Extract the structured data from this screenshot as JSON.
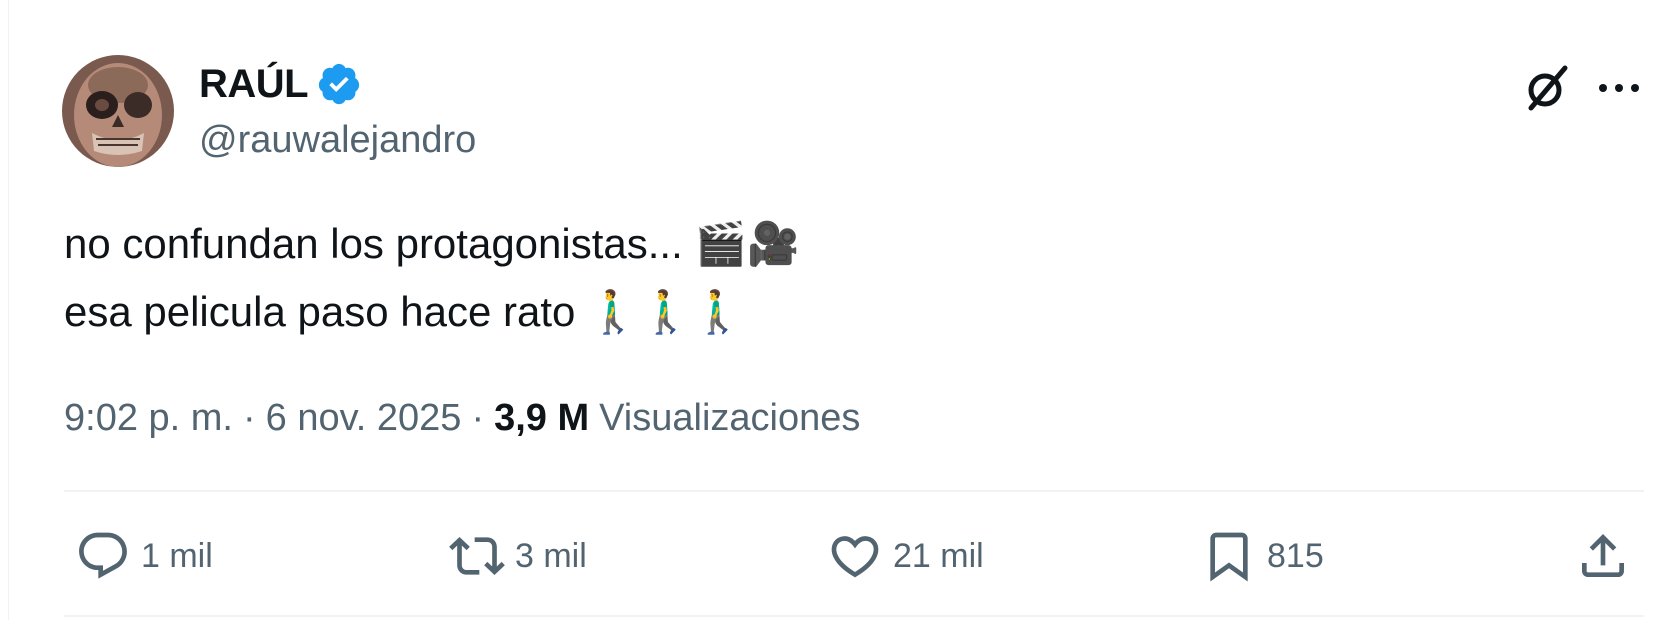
{
  "author": {
    "display_name": "RAÚL",
    "handle": "@rauwalejandro",
    "verified": true,
    "verified_color": "#1d9bf0"
  },
  "tweet": {
    "lines": [
      {
        "text": "no confundan los protagonistas...",
        "emoji": "🎬🎥"
      },
      {
        "text": "esa pelicula paso hace rato",
        "emoji": "🚶‍♂️🚶‍♂️🚶‍♂️"
      }
    ]
  },
  "meta": {
    "time": "9:02 p. m.",
    "separator": "·",
    "date": "6 nov. 2025",
    "views_count": "3,9 M",
    "views_label": "Visualizaciones"
  },
  "actions": {
    "reply": {
      "icon": "reply-icon",
      "count": "1 mil"
    },
    "retweet": {
      "icon": "retweet-icon",
      "count": "3 mil"
    },
    "like": {
      "icon": "heart-icon",
      "count": "21 mil"
    },
    "bookmark": {
      "icon": "bookmark-icon",
      "count": "815"
    },
    "share": {
      "icon": "share-icon"
    }
  },
  "header_icons": [
    "grok-icon",
    "more-icon"
  ],
  "colors": {
    "text": "#0f1419",
    "secondary": "#536471",
    "divider": "#eff3f4",
    "accent": "#1d9bf0"
  }
}
